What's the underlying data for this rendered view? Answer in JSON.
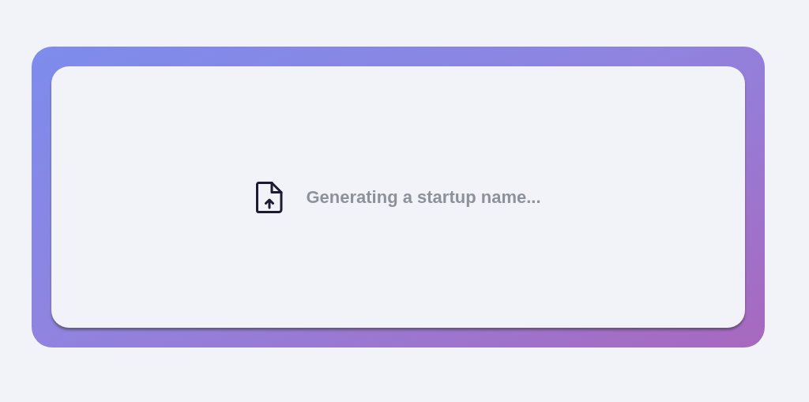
{
  "status": {
    "message": "Generating a startup name..."
  }
}
